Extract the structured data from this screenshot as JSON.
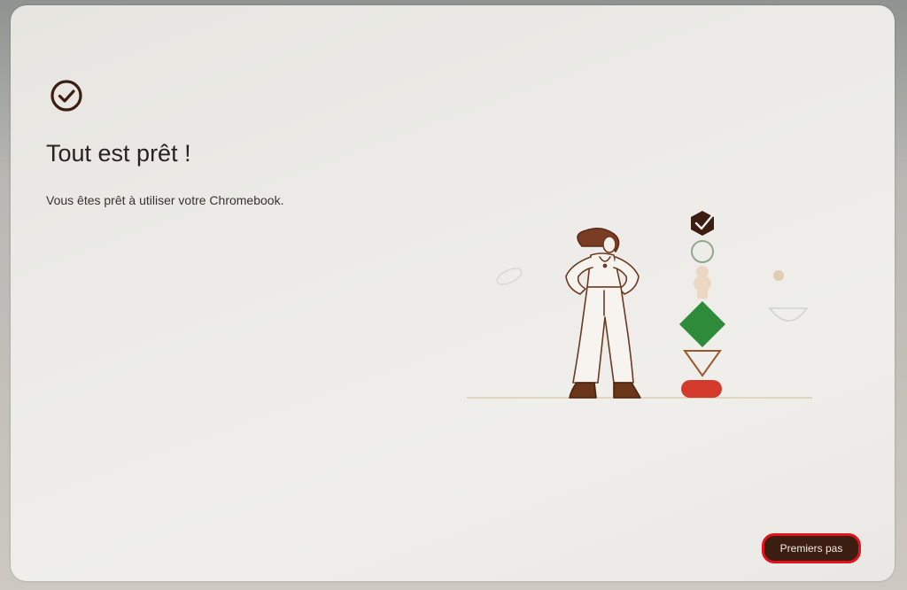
{
  "dialog": {
    "title": "Tout est prêt !",
    "subtitle": "Vous êtes prêt à utiliser votre Chromebook.",
    "primary_button_label": "Premiers pas",
    "header_icon": "check-circle-icon"
  },
  "colors": {
    "accent": "#3b1d12",
    "highlight_border": "#e3121a",
    "green_shape": "#2e8b3a",
    "red_shape": "#d33a2c"
  }
}
